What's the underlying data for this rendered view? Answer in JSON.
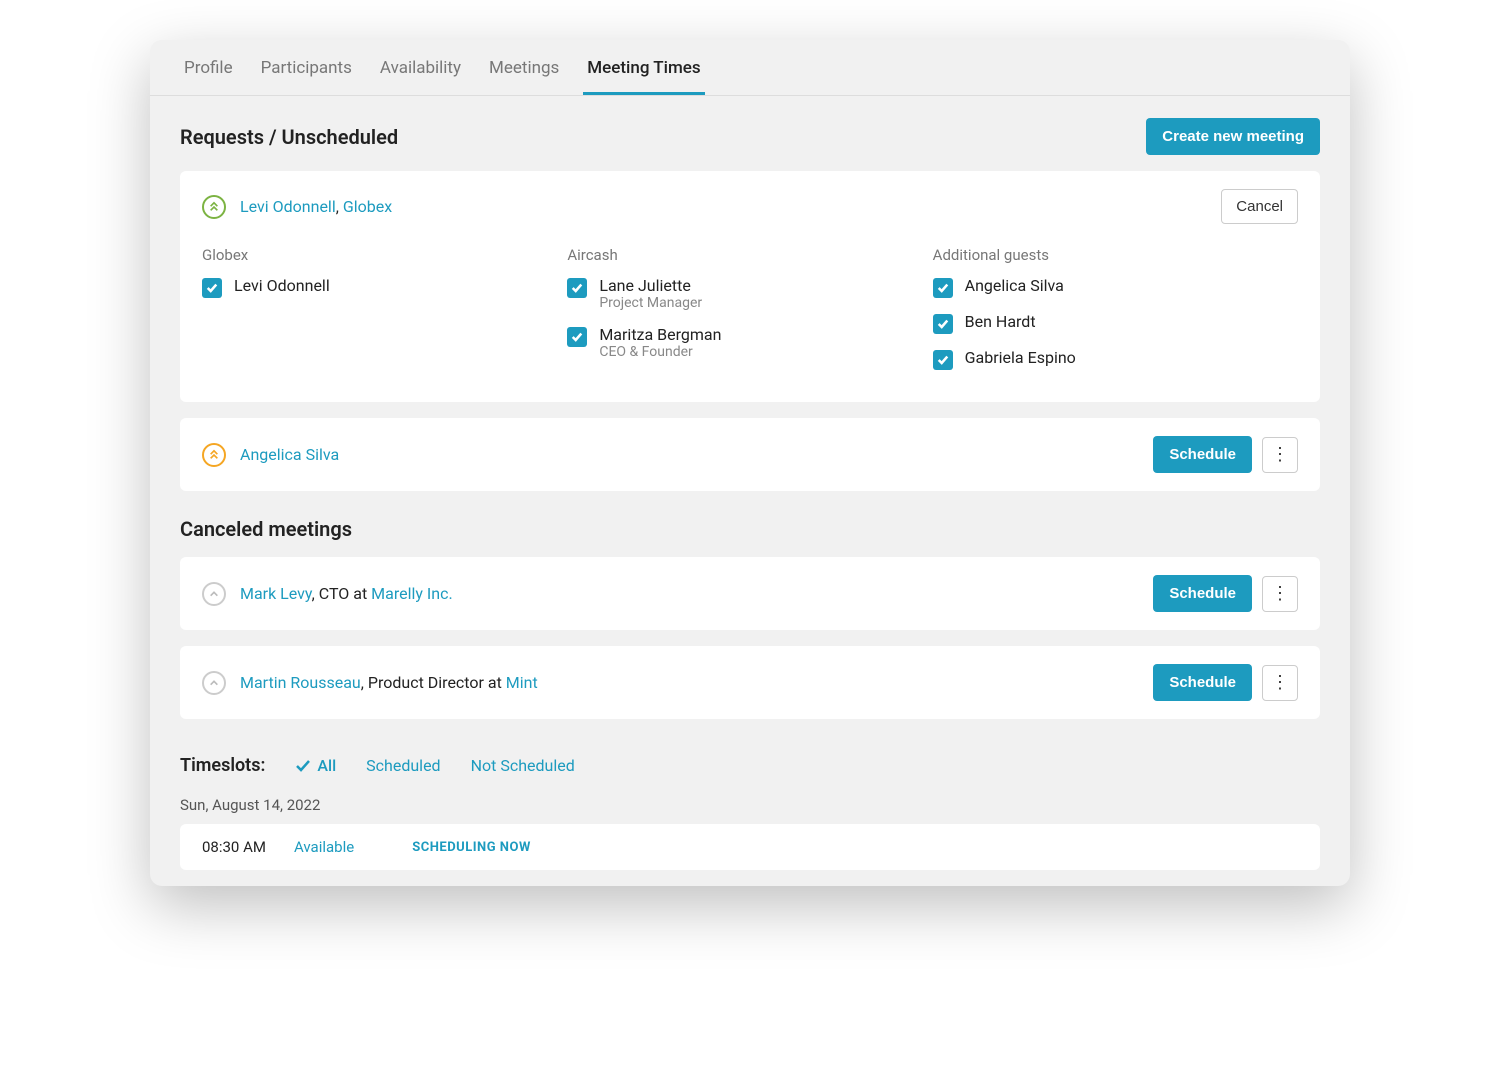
{
  "tabs": [
    "Profile",
    "Participants",
    "Availability",
    "Meetings",
    "Meeting Times"
  ],
  "activeTab": "Meeting Times",
  "sections": {
    "requests_title": "Requests / Unscheduled",
    "canceled_title": "Canceled meetings"
  },
  "buttons": {
    "create": "Create new meeting",
    "cancel": "Cancel",
    "schedule": "Schedule"
  },
  "request1": {
    "person": "Levi Odonnell",
    "company": "Globex",
    "col1": {
      "title": "Globex",
      "items": [
        {
          "name": "Levi Odonnell",
          "role": ""
        }
      ]
    },
    "col2": {
      "title": "Aircash",
      "items": [
        {
          "name": "Lane Juliette",
          "role": "Project Manager"
        },
        {
          "name": "Maritza Bergman",
          "role": "CEO & Founder"
        }
      ]
    },
    "col3": {
      "title": "Additional guests",
      "items": [
        {
          "name": "Angelica Silva",
          "role": ""
        },
        {
          "name": "Ben Hardt",
          "role": ""
        },
        {
          "name": "Gabriela Espino",
          "role": ""
        }
      ]
    }
  },
  "request2": {
    "person": "Angelica Silva"
  },
  "canceled": [
    {
      "person": "Mark Levy",
      "role": ", CTO at ",
      "company": "Marelly Inc."
    },
    {
      "person": "Martin Rousseau",
      "role": ", Product Director at ",
      "company": "Mint"
    }
  ],
  "timeslots": {
    "label": "Timeslots:",
    "filters": [
      "All",
      "Scheduled",
      "Not Scheduled"
    ],
    "date": "Sun, August 14, 2022",
    "slot": {
      "time": "08:30 AM",
      "status": "Available",
      "action": "SCHEDULING NOW"
    }
  },
  "colors": {
    "accent": "#1d9bbf"
  }
}
